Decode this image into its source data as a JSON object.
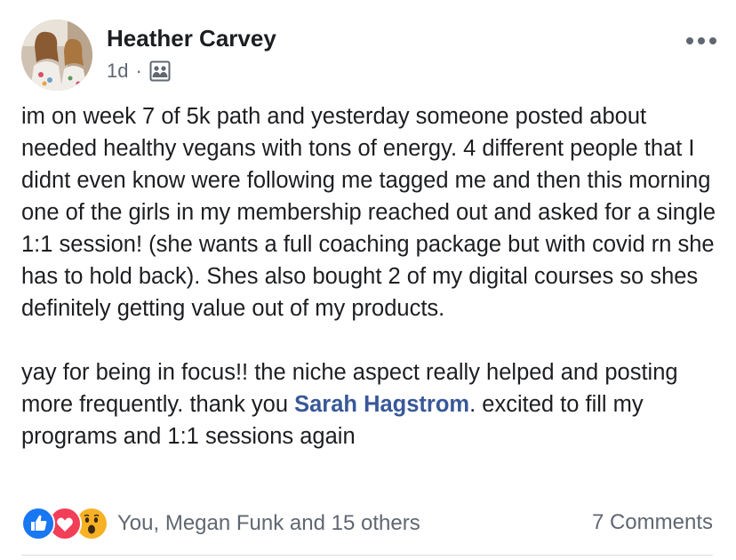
{
  "author": {
    "name": "Heather Carvey",
    "avatar_icon": "profile-photo"
  },
  "meta": {
    "time": "1d",
    "separator": "·",
    "privacy_icon": "group-members-icon"
  },
  "post": {
    "paragraph1": "im on week 7 of 5k path and yesterday someone posted about needed healthy vegans with tons of energy. 4 different people that I didnt even know were following me tagged me and then this morning one of the girls in my membership reached out and asked for a single 1:1 session! (she wants a full coaching package but with covid rn she has to hold back). Shes also bought 2 of my digital courses so shes definitely getting value out of my products.",
    "paragraph2_before": "yay for being in focus!! the niche aspect really helped and posting more frequently. thank you ",
    "mention": "Sarah Hagstrom",
    "paragraph2_after": ". excited to fill my programs and 1:1 sessions again"
  },
  "footer": {
    "reaction_icons": [
      "like-icon",
      "love-icon",
      "wow-icon"
    ],
    "reactors": "You, Megan Funk and 15 others",
    "comments": "7 Comments"
  },
  "colors": {
    "mention": "#385898",
    "secondary_text": "#606770",
    "like": "#1877f2",
    "love": "#f33e58",
    "wow": "#f7b125"
  }
}
